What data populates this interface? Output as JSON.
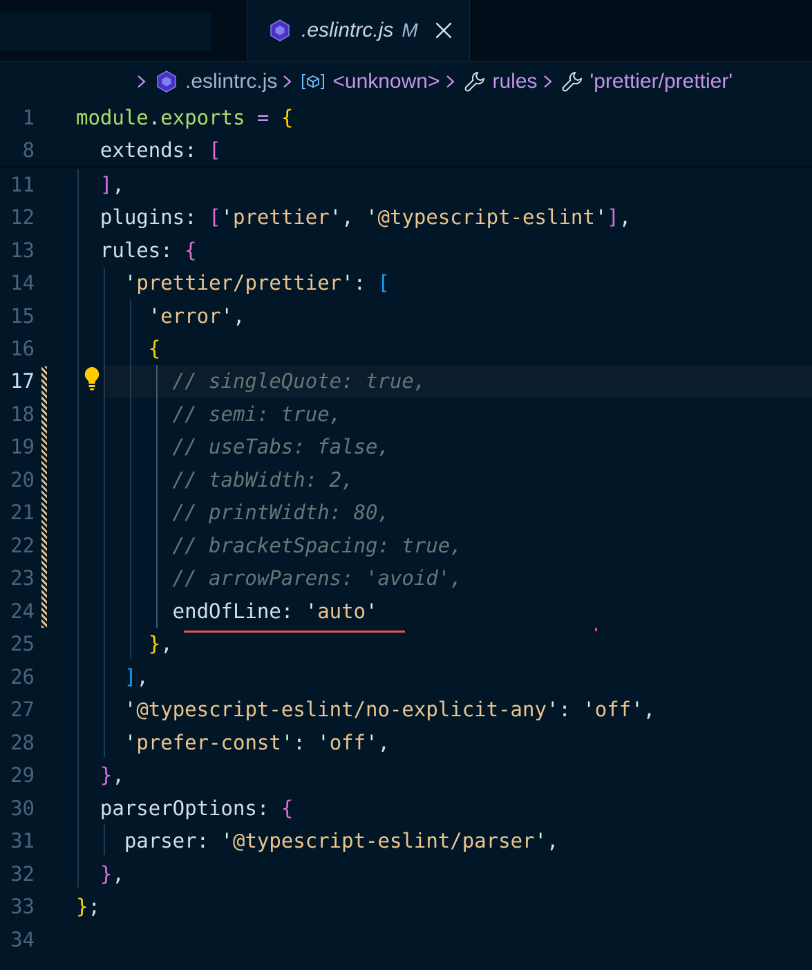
{
  "tab": {
    "filename": ".eslintrc.js",
    "status": "M",
    "icon": "eslint-icon",
    "close_icon": "close-icon"
  },
  "breadcrumb": [
    {
      "label": ".eslintrc.js",
      "icon": "eslint-icon"
    },
    {
      "label": "<unknown>",
      "icon": "variable-icon"
    },
    {
      "label": "rules",
      "icon": "wrench-icon"
    },
    {
      "label": "'prettier/prettier'",
      "icon": "wrench-icon"
    }
  ],
  "editor": {
    "active_line": "17",
    "lines": [
      {
        "n": "1",
        "tokens": [
          [
            "module",
            "fn"
          ],
          [
            ".",
            "punc"
          ],
          [
            "exports",
            "fn"
          ],
          [
            " = ",
            "op"
          ],
          [
            "{",
            "b1"
          ]
        ]
      },
      {
        "n": "8",
        "tokens": [
          [
            "  extends",
            "prop"
          ],
          [
            ": ",
            "punc"
          ],
          [
            "[",
            "b2"
          ]
        ]
      },
      {
        "n": "11",
        "tokens": [
          [
            "  ",
            "punc"
          ],
          [
            "]",
            "b2"
          ],
          [
            ",",
            "punc"
          ]
        ]
      },
      {
        "n": "12",
        "tokens": [
          [
            "  plugins",
            "prop"
          ],
          [
            ": ",
            "punc"
          ],
          [
            "[",
            "b2"
          ],
          [
            "'",
            "q"
          ],
          [
            "prettier",
            "str"
          ],
          [
            "'",
            "q"
          ],
          [
            ", ",
            "punc"
          ],
          [
            "'",
            "q"
          ],
          [
            "@typescript-eslint",
            "str"
          ],
          [
            "'",
            "q"
          ],
          [
            "]",
            "b2"
          ],
          [
            ",",
            "punc"
          ]
        ]
      },
      {
        "n": "13",
        "tokens": [
          [
            "  rules",
            "prop"
          ],
          [
            ": ",
            "punc"
          ],
          [
            "{",
            "b2"
          ]
        ]
      },
      {
        "n": "14",
        "tokens": [
          [
            "    ",
            "punc"
          ],
          [
            "'",
            "q"
          ],
          [
            "prettier/prettier",
            "str"
          ],
          [
            "'",
            "q"
          ],
          [
            ": ",
            "punc"
          ],
          [
            "[",
            "b3"
          ]
        ]
      },
      {
        "n": "15",
        "tokens": [
          [
            "      ",
            "punc"
          ],
          [
            "'",
            "q"
          ],
          [
            "error",
            "str"
          ],
          [
            "'",
            "q"
          ],
          [
            ",",
            "punc"
          ]
        ]
      },
      {
        "n": "16",
        "tokens": [
          [
            "      ",
            "punc"
          ],
          [
            "{",
            "b1"
          ]
        ]
      },
      {
        "n": "17",
        "tokens": [
          [
            "        // singleQuote: true,",
            "com"
          ]
        ]
      },
      {
        "n": "18",
        "tokens": [
          [
            "        // semi: true,",
            "com"
          ]
        ]
      },
      {
        "n": "19",
        "tokens": [
          [
            "        // useTabs: false,",
            "com"
          ]
        ]
      },
      {
        "n": "20",
        "tokens": [
          [
            "        // tabWidth: 2,",
            "com"
          ]
        ]
      },
      {
        "n": "21",
        "tokens": [
          [
            "        // printWidth: 80,",
            "com"
          ]
        ]
      },
      {
        "n": "22",
        "tokens": [
          [
            "        // bracketSpacing: true,",
            "com"
          ]
        ]
      },
      {
        "n": "23",
        "tokens": [
          [
            "        // arrowParens: 'avoid',",
            "com"
          ]
        ]
      },
      {
        "n": "24",
        "tokens": [
          [
            "        endOfLine",
            "prop"
          ],
          [
            ": ",
            "punc"
          ],
          [
            "'",
            "q"
          ],
          [
            "auto",
            "str"
          ],
          [
            "'",
            "q"
          ]
        ]
      },
      {
        "n": "25",
        "tokens": [
          [
            "      ",
            "punc"
          ],
          [
            "}",
            "b1"
          ],
          [
            ",",
            "punc"
          ]
        ]
      },
      {
        "n": "26",
        "tokens": [
          [
            "    ",
            "punc"
          ],
          [
            "]",
            "b3"
          ],
          [
            ",",
            "punc"
          ]
        ]
      },
      {
        "n": "27",
        "tokens": [
          [
            "    ",
            "punc"
          ],
          [
            "'",
            "q"
          ],
          [
            "@typescript-eslint/no-explicit-any",
            "str"
          ],
          [
            "'",
            "q"
          ],
          [
            ": ",
            "punc"
          ],
          [
            "'",
            "q"
          ],
          [
            "off",
            "str"
          ],
          [
            "'",
            "q"
          ],
          [
            ",",
            "punc"
          ]
        ]
      },
      {
        "n": "28",
        "tokens": [
          [
            "    ",
            "punc"
          ],
          [
            "'",
            "q"
          ],
          [
            "prefer-const",
            "str"
          ],
          [
            "'",
            "q"
          ],
          [
            ": ",
            "punc"
          ],
          [
            "'",
            "q"
          ],
          [
            "off",
            "str"
          ],
          [
            "'",
            "q"
          ],
          [
            ",",
            "punc"
          ]
        ]
      },
      {
        "n": "29",
        "tokens": [
          [
            "  ",
            "punc"
          ],
          [
            "}",
            "b2"
          ],
          [
            ",",
            "punc"
          ]
        ]
      },
      {
        "n": "30",
        "tokens": [
          [
            "  parserOptions",
            "prop"
          ],
          [
            ": ",
            "punc"
          ],
          [
            "{",
            "b2"
          ]
        ]
      },
      {
        "n": "31",
        "tokens": [
          [
            "    parser",
            "prop"
          ],
          [
            ": ",
            "punc"
          ],
          [
            "'",
            "q"
          ],
          [
            "@typescript-eslint/parser",
            "str"
          ],
          [
            "'",
            "q"
          ],
          [
            ",",
            "punc"
          ]
        ]
      },
      {
        "n": "32",
        "tokens": [
          [
            "  ",
            "punc"
          ],
          [
            "}",
            "b2"
          ],
          [
            ",",
            "punc"
          ]
        ]
      },
      {
        "n": "33",
        "tokens": [
          [
            "}",
            "b1"
          ],
          [
            ";",
            "punc"
          ]
        ]
      },
      {
        "n": "34",
        "tokens": []
      }
    ]
  },
  "colors": {
    "background": "#011627",
    "keyword": "#c792ea",
    "string": "#ecc48d",
    "comment": "#637777",
    "error_squiggle": "#ef5350",
    "modified_gutter": "#e2c08d",
    "lightbulb": "#ffcc00"
  }
}
